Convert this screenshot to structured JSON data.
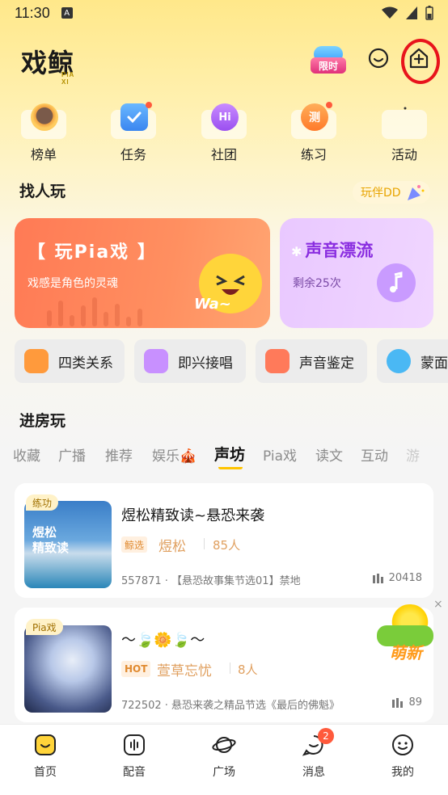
{
  "status_bar": {
    "time": "11:30",
    "sim_label": "A"
  },
  "header": {
    "logo_text": "戏鲸",
    "logo_sub": "PIA XI",
    "promo_label": "限时"
  },
  "quick_nav": [
    {
      "label": "榜单",
      "icon": "avatar-medal-icon",
      "dot": false
    },
    {
      "label": "任务",
      "icon": "calendar-check-icon",
      "dot": true
    },
    {
      "label": "社团",
      "icon": "hi-chat-icon",
      "dot": false
    },
    {
      "label": "练习",
      "icon": "test-badge-icon",
      "dot": true
    },
    {
      "label": "活动",
      "icon": "event-icon",
      "dot": false
    }
  ],
  "find_people": {
    "title": "找人玩",
    "partner_label": "玩伴DD",
    "pia_card": {
      "title": "【 玩Pia戏 】",
      "subtitle": "戏感是角色的灵魂",
      "mascot_text": "Wa~"
    },
    "drift_card": {
      "title": "声音漂流",
      "subtitle": "剩余25次"
    }
  },
  "features": [
    {
      "label": "四类关系",
      "icon": "puzzle-icon",
      "color": "#ff9a3c"
    },
    {
      "label": "即兴接唱",
      "icon": "music-note-icon",
      "color": "#b06cf0"
    },
    {
      "label": "声音鉴定",
      "icon": "id-card-icon",
      "color": "#ff6a4a"
    },
    {
      "label": "蒙面",
      "icon": "mask-icon",
      "color": "#3ab0f0"
    }
  ],
  "rooms_section": {
    "title": "进房玩",
    "tabs": [
      "收藏",
      "广播",
      "推荐",
      "娱乐🎪",
      "声坊",
      "Pia戏",
      "读文",
      "互动",
      "游"
    ],
    "active_tab_index": 4
  },
  "rooms": [
    {
      "tag": "练功",
      "title": "煜松精致读~悬恐来袭",
      "thumb_text": "煜松\n精致读",
      "badge": "鲸选",
      "host": "煜松",
      "people": "85人",
      "meta": "557871 · 【悬恐故事集节选01】禁地",
      "listeners": "20418"
    },
    {
      "tag": "Pia戏",
      "title": "〜🍃🌼🍃〜",
      "badge": "HOT",
      "host": "萱草忘忧",
      "people": "8人",
      "meta": "722502 · 悬恐来袭之精品节选《最后的佛魁》",
      "listeners": "89"
    }
  ],
  "float_ad": {
    "text": "萌新",
    "close": "×"
  },
  "bottom_nav": [
    {
      "label": "首页",
      "icon": "home-icon",
      "active": true
    },
    {
      "label": "配音",
      "icon": "dubbing-icon"
    },
    {
      "label": "广场",
      "icon": "planet-icon"
    },
    {
      "label": "消息",
      "icon": "message-icon",
      "badge": "2"
    },
    {
      "label": "我的",
      "icon": "profile-icon"
    }
  ]
}
